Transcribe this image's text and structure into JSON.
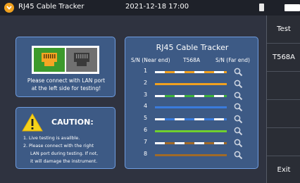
{
  "topbar": {
    "app_title": "RJ45 Cable Tracker",
    "datetime": "2021-12-18 17:00"
  },
  "softkeys": {
    "k1": "Test",
    "k2": "T568A",
    "k3": "",
    "k4": "",
    "k5": "",
    "k6": "Exit"
  },
  "port_panel": {
    "line1": "Please connect with LAN port",
    "line2": "at the left side for testing!"
  },
  "caution": {
    "title": "CAUTION:",
    "l1": "1. Live testing is availble.",
    "l2": "2. Please connect with the right",
    "l3": "LAN port during testing. If not,",
    "l4": "it will damage the instrument."
  },
  "tracker": {
    "title": "RJ45 Cable Tracker",
    "near_end": "S/N (Near end)",
    "standard": "T568A",
    "far_end": "S/N (Far end)",
    "wires": [
      {
        "n": "1",
        "color": "#ffffff",
        "stripe": "#f0a020"
      },
      {
        "n": "2",
        "color": "#f0a020",
        "stripe": ""
      },
      {
        "n": "3",
        "color": "#ffffff",
        "stripe": "#3db33d"
      },
      {
        "n": "4",
        "color": "#3a7bdc",
        "stripe": ""
      },
      {
        "n": "5",
        "color": "#ffffff",
        "stripe": "#3a7bdc"
      },
      {
        "n": "6",
        "color": "#6fcf2f",
        "stripe": ""
      },
      {
        "n": "7",
        "color": "#ffffff",
        "stripe": "#a06a28"
      },
      {
        "n": "8",
        "color": "#a06a28",
        "stripe": ""
      }
    ]
  }
}
